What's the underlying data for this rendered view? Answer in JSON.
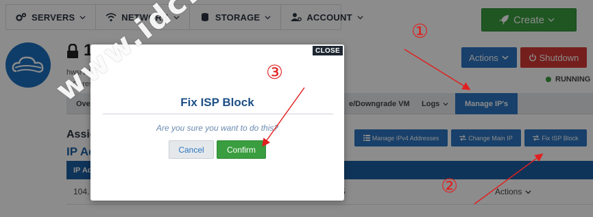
{
  "topnav": {
    "items": [
      {
        "label": "SERVERS",
        "icon": "cogs-icon"
      },
      {
        "label": "NETWORK",
        "icon": "wifi-icon"
      },
      {
        "label": "STORAGE",
        "icon": "database-icon"
      },
      {
        "label": "ACCOUNT",
        "icon": "user-gear-icon"
      }
    ],
    "create_label": "Create"
  },
  "server": {
    "title_visible": "1",
    "hostname_partial": "hwsrv-3",
    "cores_partial": "1 Cores"
  },
  "header_actions": {
    "actions_label": "Actions",
    "shutdown_label": "Shutdown",
    "status_label": "RUNNING",
    "status_color": "#3a9d3f"
  },
  "tabs": {
    "first_partial": "Ove",
    "upgrade_partial": "e/Downgrade VM",
    "logs_label": "Logs",
    "active_label": "Manage IP's"
  },
  "ip_section": {
    "section_partial": "Assig",
    "heading_partial": "IP Ac",
    "buttons": {
      "manage_ipv4": "Manage IPv4 Addresses",
      "change_main_ip": "Change Main IP",
      "fix_isp_block": "Fix ISP Block"
    },
    "table_head_partial": "IP Ad",
    "row": {
      "ip_partial": "104.",
      "suffix_partial": "5",
      "actions_label": "Actions"
    }
  },
  "modal": {
    "close_label": "CLOSE",
    "title": "Fix ISP Block",
    "question": "Are you sure you want to do this?",
    "cancel_label": "Cancel",
    "confirm_label": "Confirm"
  },
  "annotations": {
    "marker_1": "①",
    "marker_2": "②",
    "marker_3": "③",
    "color": "#e02020"
  },
  "watermark": {
    "text": "www.idc.co"
  },
  "colors": {
    "primary": "#2c75c1",
    "success": "#3a9d3f",
    "danger": "#d33a35",
    "navy": "#1c5fa3"
  }
}
